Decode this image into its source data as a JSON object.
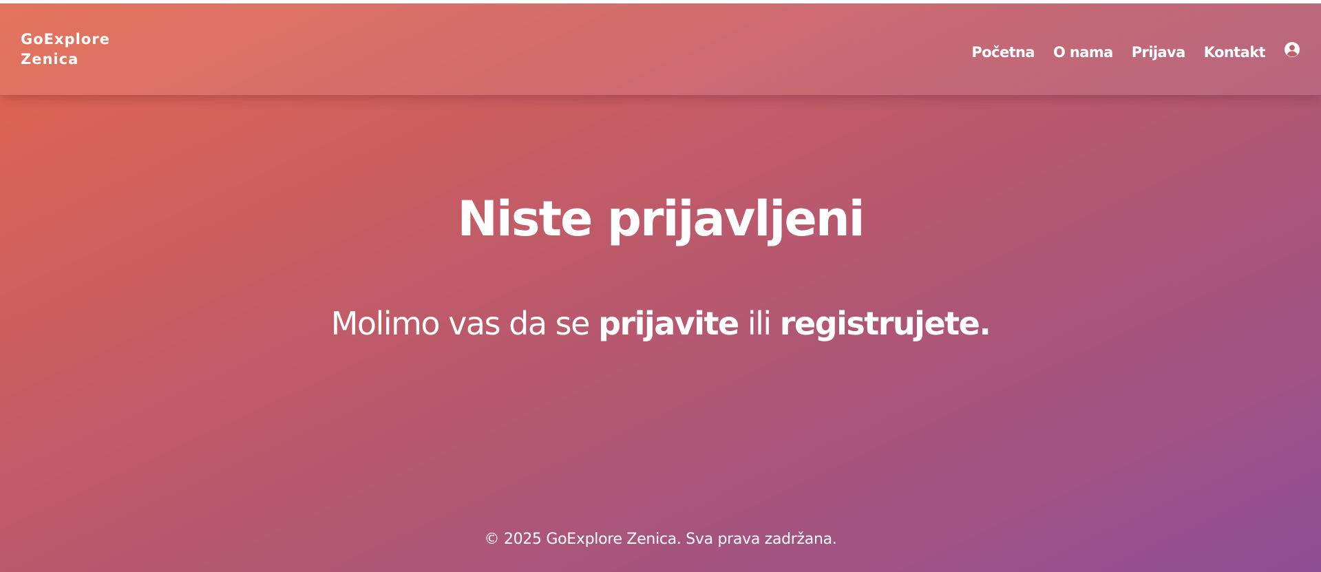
{
  "brand": {
    "line1": "GoExplore",
    "line2": "Zenica"
  },
  "nav": {
    "items": [
      {
        "label": "Početna"
      },
      {
        "label": "O nama"
      },
      {
        "label": "Prijava"
      },
      {
        "label": "Kontakt"
      }
    ],
    "user_icon": "user-circle-icon"
  },
  "hero": {
    "title": "Niste prijavljeni",
    "message_prefix": "Molimo vas da se ",
    "login_link": "prijavite",
    "message_middle": " ili ",
    "register_link": "registrujete."
  },
  "footer": {
    "text": "© 2025 GoExplore Zenica. Sva prava zadržana."
  },
  "colors": {
    "gradient_start": "#e3674c",
    "gradient_end": "#904e94",
    "text": "#ffffff"
  }
}
